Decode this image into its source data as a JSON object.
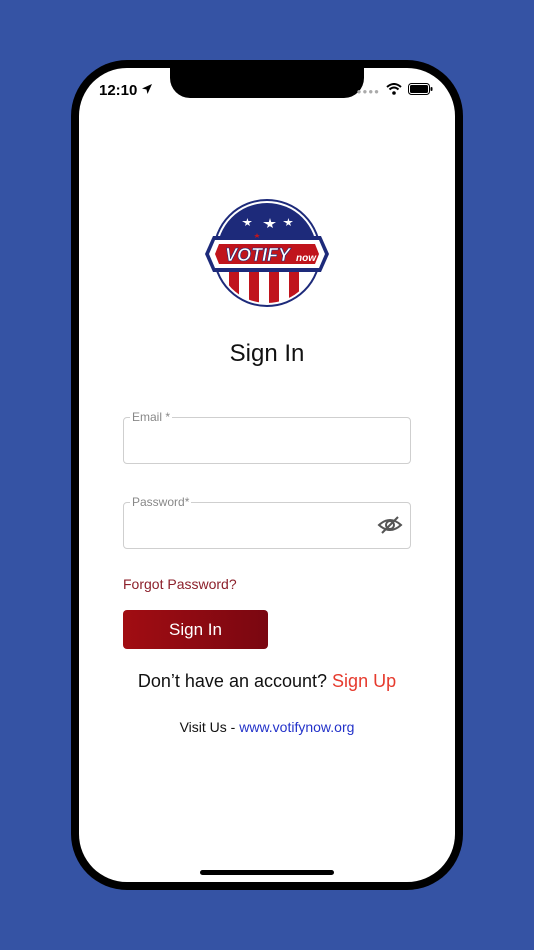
{
  "status_bar": {
    "time": "12:10"
  },
  "logo": {
    "text_main": "VOTIFY",
    "text_suffix": "now"
  },
  "page": {
    "title": "Sign In"
  },
  "form": {
    "email_label": "Email *",
    "email_value": "",
    "password_label": "Password*",
    "password_value": "",
    "forgot_label": "Forgot Password?",
    "signin_label": "Sign In"
  },
  "footer": {
    "account_prompt": "Don’t have an account?",
    "signup_label": "Sign Up",
    "visit_prefix": "Visit Us - ",
    "visit_link": "www.votifynow.org"
  },
  "colors": {
    "background": "#3553a4",
    "brand_red": "#a10d12",
    "link_red": "#e63a2d",
    "link_blue": "#2332c9",
    "logo_navy": "#1d2a7a"
  },
  "icons": [
    "location-arrow-icon",
    "wifi-icon",
    "battery-icon",
    "eye-slash-icon"
  ]
}
